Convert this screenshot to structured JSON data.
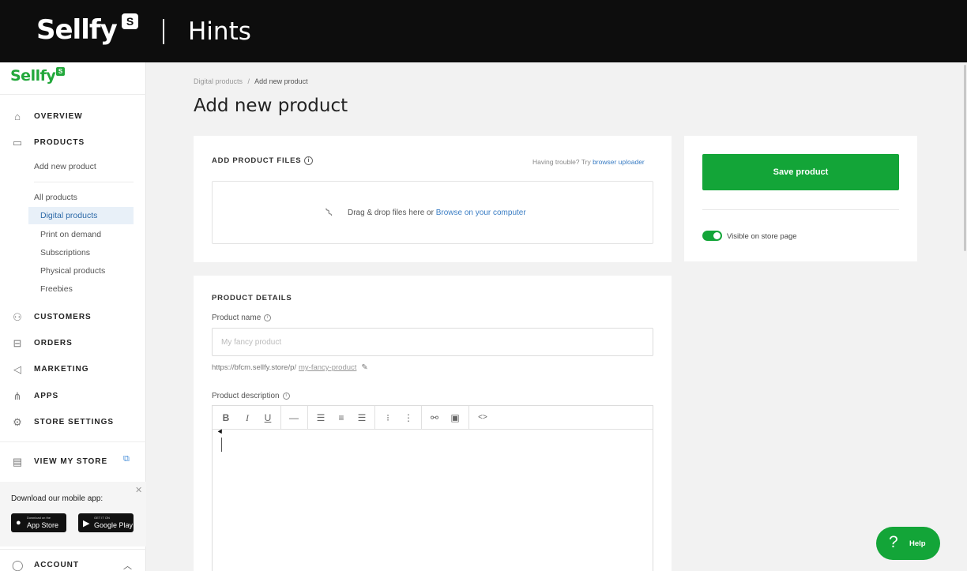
{
  "banner": {
    "logo": "Sellfy",
    "logo_badge": "S",
    "title": "Hints"
  },
  "sidebar": {
    "logo": "Sellfy",
    "logo_badge": "S",
    "nav": {
      "overview": "OVERVIEW",
      "products": "PRODUCTS",
      "add_new_product": "Add new product",
      "all_products": "All products",
      "digital_products": "Digital products",
      "print_on_demand": "Print on demand",
      "subscriptions": "Subscriptions",
      "physical_products": "Physical products",
      "freebies": "Freebies",
      "customers": "CUSTOMERS",
      "orders": "ORDERS",
      "marketing": "MARKETING",
      "apps": "APPS",
      "store_settings": "STORE SETTINGS",
      "view_my_store": "VIEW MY STORE",
      "account": "ACCOUNT"
    },
    "mobile_app": {
      "title": "Download our mobile app:",
      "app_store_small": "Download on the",
      "app_store": "App Store",
      "google_play_small": "GET IT ON",
      "google_play": "Google Play"
    }
  },
  "breadcrumb": {
    "parent": "Digital products",
    "separator": "/",
    "current": "Add new product"
  },
  "page_title": "Add new product",
  "files_card": {
    "title": "ADD PRODUCT FILES",
    "trouble_text": "Having trouble? Try",
    "trouble_link": "browser uploader",
    "drop_text": "Drag & drop files here or",
    "browse_link": "Browse on your computer"
  },
  "details_card": {
    "title": "PRODUCT DETAILS",
    "name_label": "Product name",
    "name_placeholder": "My fancy product",
    "url_prefix": "https://bfcm.sellfy.store/p/",
    "url_slug": "my-fancy-product",
    "description_label": "Product description"
  },
  "side_card": {
    "save_button": "Save product",
    "visible_label": "Visible on store page",
    "visible_on": true
  },
  "help_button": {
    "icon": "?",
    "label": "Help"
  },
  "colors": {
    "brand_green": "#13a538",
    "link_blue": "#3a7dc4"
  }
}
